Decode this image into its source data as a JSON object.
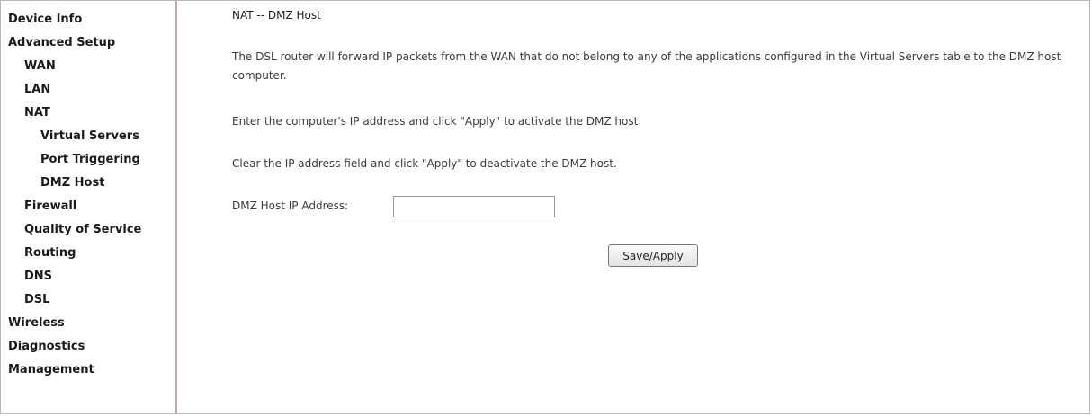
{
  "sidebar": {
    "items": [
      {
        "label": "Device Info"
      },
      {
        "label": "Advanced Setup"
      },
      {
        "label": "WAN"
      },
      {
        "label": "LAN"
      },
      {
        "label": "NAT"
      },
      {
        "label": "Virtual Servers"
      },
      {
        "label": "Port Triggering"
      },
      {
        "label": "DMZ Host"
      },
      {
        "label": "Firewall"
      },
      {
        "label": "Quality of Service"
      },
      {
        "label": "Routing"
      },
      {
        "label": "DNS"
      },
      {
        "label": "DSL"
      },
      {
        "label": "Wireless"
      },
      {
        "label": "Diagnostics"
      },
      {
        "label": "Management"
      }
    ]
  },
  "main": {
    "title": "NAT -- DMZ Host",
    "description": "The DSL router will forward IP packets from the WAN that do not belong to any of the applications configured in the Virtual Servers table to the DMZ host computer.",
    "instruction_activate": "Enter the computer's IP address and click \"Apply\" to activate the DMZ host.",
    "instruction_deactivate": "Clear the IP address field and click \"Apply\" to deactivate the DMZ host.",
    "ip_label": "DMZ Host IP Address:",
    "ip_value": "",
    "apply_label": "Save/Apply"
  }
}
